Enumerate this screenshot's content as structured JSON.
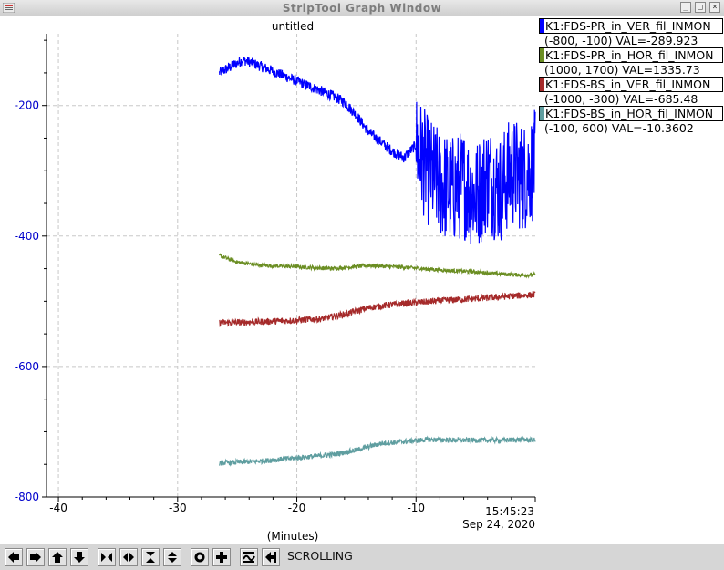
{
  "window": {
    "title": "StripTool Graph Window"
  },
  "graph": {
    "title": "untitled",
    "x_axis_label": "(Minutes)",
    "time_label": "15:45:23",
    "date_label": "Sep 24, 2020"
  },
  "legend": [
    {
      "name": "K1:FDS-PR_in_VER_fil_INMON",
      "range_value": "(-800, -100) VAL=-289.923",
      "color": "#0000ff"
    },
    {
      "name": "K1:FDS-PR_in_HOR_fil_INMON",
      "range_value": "(1000, 1700) VAL=1335.73",
      "color": "#6b8e23"
    },
    {
      "name": "K1:FDS-BS_in_VER_fil_INMON",
      "range_value": "(-1000, -300) VAL=-685.48",
      "color": "#a52a2a"
    },
    {
      "name": "K1:FDS-BS_in_HOR_fil_INMON",
      "range_value": "(-100, 600) VAL=-10.3602",
      "color": "#5f9ea0"
    }
  ],
  "toolbar": {
    "status": "SCROLLING",
    "buttons": [
      "left-arrow-icon",
      "right-arrow-icon",
      "up-arrow-icon",
      "down-arrow-icon",
      "zoom-in-horizontal-icon",
      "zoom-out-horizontal-icon",
      "zoom-in-vertical-icon",
      "zoom-out-vertical-icon",
      "reset-icon",
      "crosshair-icon",
      "autoscale-icon",
      "last-icon"
    ]
  },
  "chart_data": {
    "type": "line",
    "title": "untitled",
    "xlabel": "(Minutes)",
    "ylabel": "",
    "x_ticks": [
      -40,
      -30,
      -20,
      -10
    ],
    "y_ticks": [
      -200,
      -400,
      -600,
      -800
    ],
    "xlim": [
      -41,
      0
    ],
    "ylim": [
      -800,
      -90
    ],
    "grid": true,
    "series": [
      {
        "name": "K1:FDS-PR_in_VER_fil_INMON",
        "color": "#0000ff",
        "noise": 8,
        "x": [
          -26.5,
          -25.5,
          -24.5,
          -23,
          -21,
          -19,
          -17,
          -16,
          -15,
          -14,
          -13,
          -12,
          -11,
          -10,
          -9,
          -8,
          -7,
          -6,
          -5,
          -4,
          -3,
          -2,
          -1,
          0
        ],
        "y": [
          -150,
          -140,
          -130,
          -140,
          -155,
          -170,
          -185,
          -195,
          -215,
          -240,
          -255,
          -270,
          -280,
          -260,
          -300,
          -320,
          -330,
          -320,
          -340,
          -310,
          -330,
          -300,
          -310,
          -289.9
        ],
        "burst_from": -10,
        "burst_amp": 85
      },
      {
        "name": "K1:FDS-PR_in_HOR_fil_INMON",
        "color": "#6b8e23",
        "noise": 3,
        "x": [
          -26.5,
          -25,
          -23,
          -20,
          -17,
          -14,
          -11,
          -8,
          -5,
          -3,
          -1,
          0
        ],
        "y": [
          -430,
          -440,
          -445,
          -447,
          -450,
          -445,
          -448,
          -452,
          -455,
          -458,
          -460,
          -459
        ]
      },
      {
        "name": "K1:FDS-BS_in_VER_fil_INMON",
        "color": "#a52a2a",
        "noise": 5,
        "x": [
          -26.5,
          -24,
          -21,
          -18,
          -16,
          -14,
          -12,
          -10,
          -7,
          -4,
          -2,
          0
        ],
        "y": [
          -533,
          -532,
          -530,
          -527,
          -520,
          -510,
          -505,
          -502,
          -498,
          -495,
          -492,
          -490
        ]
      },
      {
        "name": "K1:FDS-BS_in_HOR_fil_INMON",
        "color": "#5f9ea0",
        "noise": 4,
        "x": [
          -26.5,
          -23,
          -20,
          -17,
          -15,
          -13,
          -11,
          -9,
          -6,
          -3,
          -1,
          0
        ],
        "y": [
          -748,
          -745,
          -740,
          -735,
          -728,
          -718,
          -715,
          -712,
          -713,
          -713,
          -712,
          -713
        ]
      }
    ]
  }
}
